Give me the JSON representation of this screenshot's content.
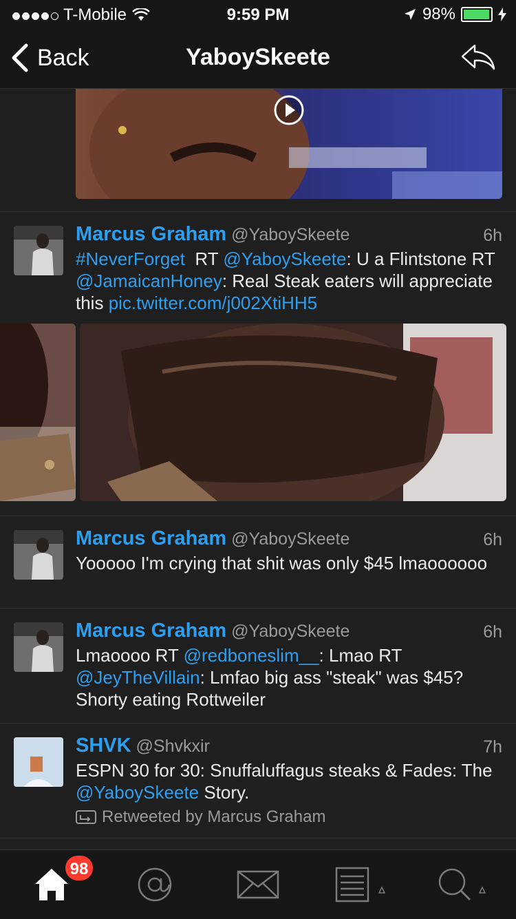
{
  "status_bar": {
    "carrier": "T-Mobile",
    "time": "9:59 PM",
    "battery": "98%",
    "battery_level": 0.98
  },
  "nav": {
    "back_label": "Back",
    "title": "YaboySkeete"
  },
  "tweets": [
    {
      "name": "Marcus Graham",
      "handle": "@YaboySkeete",
      "time": "6h",
      "text_parts": [
        "#NeverForget",
        "  RT ",
        "@YaboySkeete",
        ": U a Flintstone RT ",
        "@JamaicanHoney",
        ": Real Steak eaters will appreciate this ",
        "pic.twitter.com/j002XtiHH5"
      ]
    },
    {
      "name": "Marcus Graham",
      "handle": "@YaboySkeete",
      "time": "6h",
      "text": "Yooooo I'm crying that shit was only $45 lmaoooooo"
    },
    {
      "name": "Marcus Graham",
      "handle": "@YaboySkeete",
      "time": "6h",
      "text_parts": [
        "Lmaoooo RT ",
        "@redboneslim__",
        ": Lmao RT ",
        "@JeyTheVillain",
        ": Lmfao big ass \"steak\" was $45? Shorty eating Rottweiler"
      ]
    },
    {
      "name": "SHVK",
      "handle": "@Shvkxir",
      "time": "7h",
      "text_parts": [
        "ESPN 30 for 30: Snuffaluffagus steaks & Fades: The ",
        "@YaboySkeete",
        " Story."
      ],
      "retweeted_by": "Retweeted by Marcus Graham"
    }
  ],
  "tab_bar": {
    "home_badge": "98"
  },
  "colors": {
    "link": "#2d9ff0",
    "background": "#1f1f1f",
    "bar": "#161616",
    "badge": "#ff3b30"
  }
}
